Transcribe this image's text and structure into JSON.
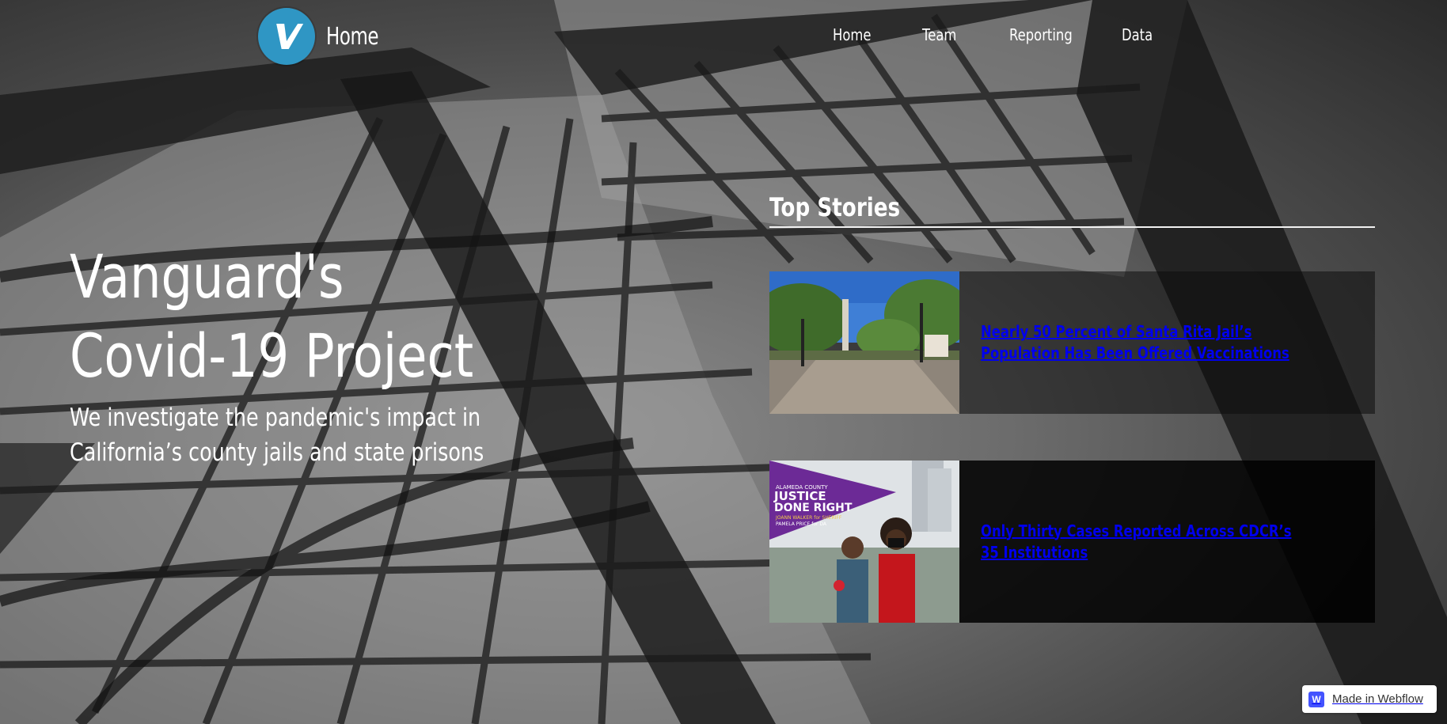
{
  "header": {
    "brand_label": "Home",
    "logo_letter": "V",
    "logo_color": "#2f96c4",
    "nav": [
      {
        "label": "Home"
      },
      {
        "label": "Team"
      },
      {
        "label": "Reporting"
      },
      {
        "label": "Data"
      }
    ]
  },
  "hero": {
    "title_line1": "Vanguard's",
    "title_line2": "Covid-19 Project",
    "subtitle_line1": "We investigate the pandemic's impact in",
    "subtitle_line2": "California’s county jails and state prisons"
  },
  "stories": {
    "heading": "Top Stories",
    "items": [
      {
        "title": "Nearly 50 Percent of Santa Rita Jail’s Population Has Been Offered Vaccinations",
        "thumb_icon": "street-photo"
      },
      {
        "title": "Only Thirty Cases Reported Across CDCR’s 35 Institutions",
        "thumb_icon": "campaign-photo"
      }
    ],
    "poster": {
      "line1": "ALAMEDA COUNTY",
      "line2": "JUSTICE",
      "line3": "DONE RIGHT",
      "line4": "JOANN WALKER for SHERIFF",
      "line5": "PAMELA PRICE for DA"
    }
  },
  "badge": {
    "icon_letter": "W",
    "label": "Made in Webflow",
    "icon_color": "#4353ff"
  }
}
